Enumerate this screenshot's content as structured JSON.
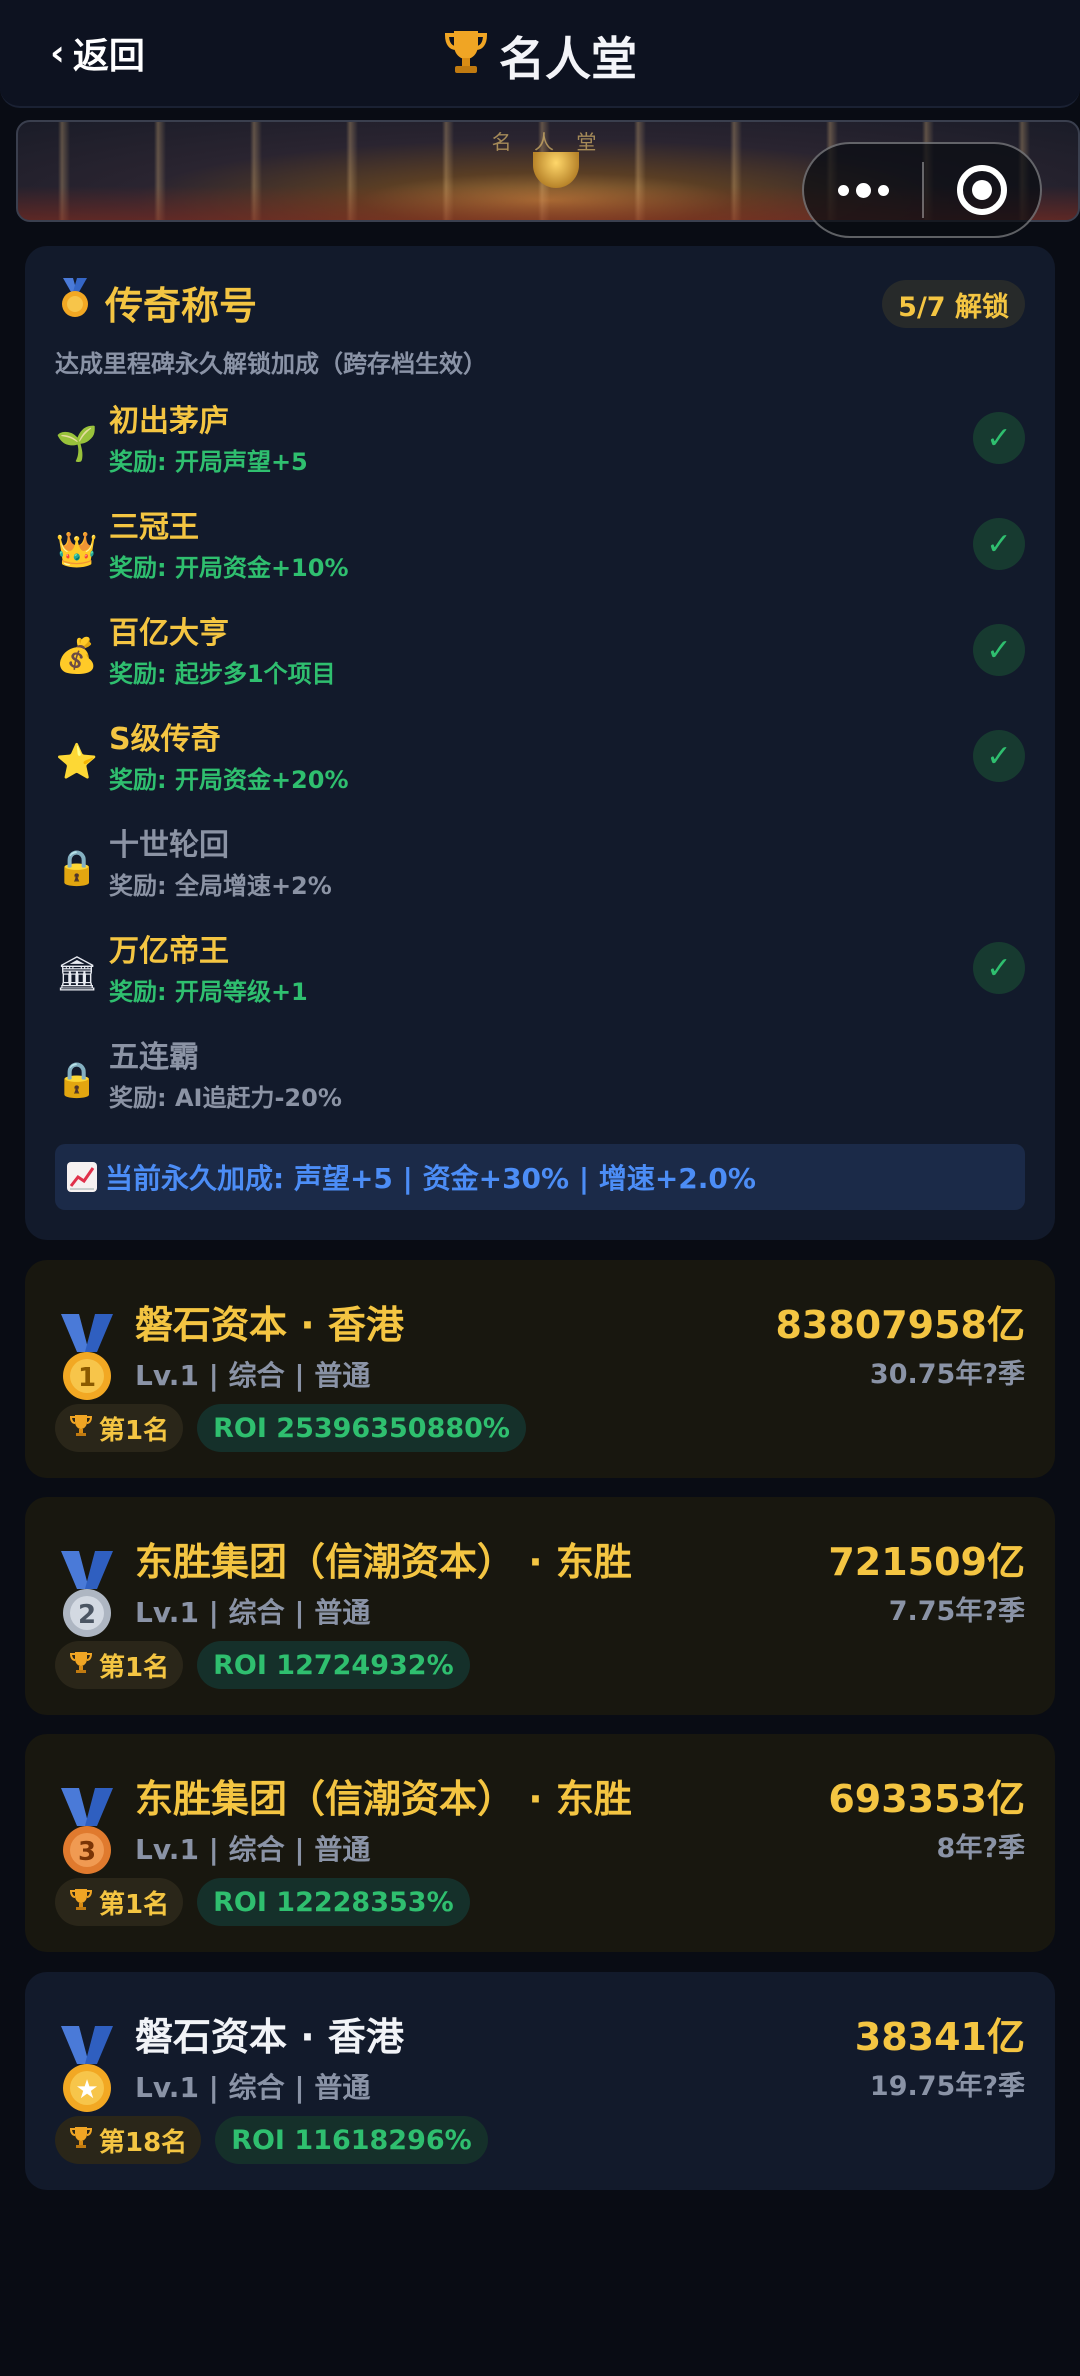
{
  "header": {
    "back_label": "返回",
    "title": "名人堂",
    "title_icon": "trophy-icon"
  },
  "banner": {
    "hall_text": "名 人 堂"
  },
  "legend": {
    "title": "传奇称号",
    "unlock_status": "5/7 解锁",
    "subtitle": "达成里程碑永久解锁加成（跨存档生效）",
    "items": [
      {
        "icon": "🌱",
        "name": "初出茅庐",
        "reward": "奖励: 开局声望+5",
        "unlocked": true
      },
      {
        "icon": "👑",
        "name": "三冠王",
        "reward": "奖励: 开局资金+10%",
        "unlocked": true
      },
      {
        "icon": "💰",
        "name": "百亿大亨",
        "reward": "奖励: 起步多1个项目",
        "unlocked": true
      },
      {
        "icon": "⭐",
        "name": "S级传奇",
        "reward": "奖励: 开局资金+20%",
        "unlocked": true
      },
      {
        "icon": "🔒",
        "name": "十世轮回",
        "reward": "奖励: 全局增速+2%",
        "unlocked": false
      },
      {
        "icon": "🏛",
        "name": "万亿帝王",
        "reward": "奖励: 开局等级+1",
        "unlocked": true
      },
      {
        "icon": "🔒",
        "name": "五连霸",
        "reward": "奖励: AI追赶力-20%",
        "unlocked": false
      }
    ],
    "check_mark": "✓",
    "bonus_text": "当前永久加成: 声望+5 | 资金+30% | 增速+2.0%"
  },
  "ranking": [
    {
      "medal": "1",
      "name": "磐石资本 · 香港",
      "meta": "Lv.1 | 综合 | 普通",
      "value": "83807958亿",
      "time": "30.75年?季",
      "rank": "第1名",
      "roi": "ROI 25396350880%"
    },
    {
      "medal": "2",
      "name": "东胜集团（信潮资本） · 东胜",
      "meta": "Lv.1 | 综合 | 普通",
      "value": "721509亿",
      "time": "7.75年?季",
      "rank": "第1名",
      "roi": "ROI 12724932%"
    },
    {
      "medal": "3",
      "name": "东胜集团（信潮资本） · 东胜",
      "meta": "Lv.1 | 综合 | 普通",
      "value": "693353亿",
      "time": "8年?季",
      "rank": "第1名",
      "roi": "ROI 12228353%"
    },
    {
      "medal": "★",
      "name": "磐石资本 · 香港",
      "meta": "Lv.1 | 综合 | 普通",
      "value": "38341亿",
      "time": "19.75年?季",
      "rank": "第18名",
      "roi": "ROI 11618296%"
    }
  ],
  "colors": {
    "gold": "#f4c542",
    "green": "#2fbf6f",
    "blue": "#4c8df6",
    "muted": "#8a93a6"
  }
}
